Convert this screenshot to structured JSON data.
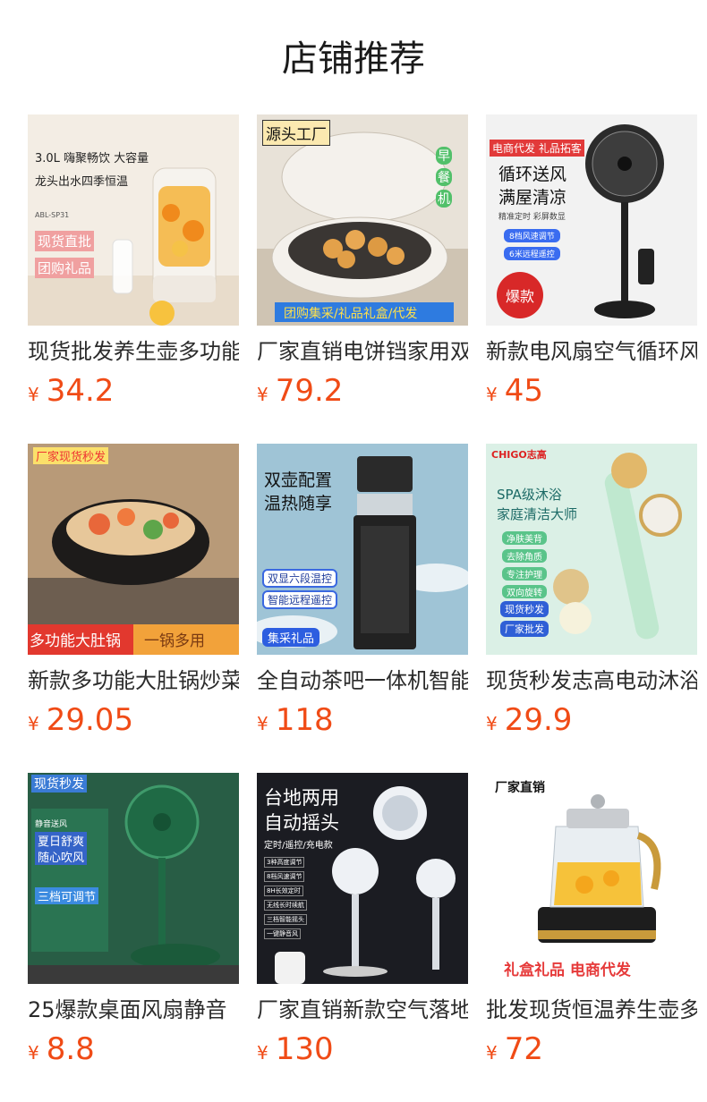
{
  "page_title": "店铺推荐",
  "currency_symbol": "¥",
  "products": [
    {
      "name": "现货批发养生壶多功能",
      "price": "34.2",
      "overlay": {
        "lines": [
          "3.0L 嗨聚畅饮 大容量",
          "龙头出水四季恒温",
          "ABL-SP31",
          "现货直批",
          "团购礼品"
        ]
      }
    },
    {
      "name": "厂家直销电饼铛家用双面",
      "price": "79.2",
      "overlay": {
        "lines": [
          "源头工厂",
          "早",
          "餐",
          "机",
          "团购集采/礼品礼盒/代发"
        ]
      }
    },
    {
      "name": "新款电风扇空气循环风扇",
      "price": "45",
      "overlay": {
        "lines": [
          "电商代发 礼品拓客",
          "循环送风",
          "满屋清凉",
          "精准定时 彩屏数显",
          "8档风速调节",
          "6米远程遥控",
          "爆款"
        ]
      }
    },
    {
      "name": "新款多功能大肚锅炒菜锅",
      "price": "29.05",
      "overlay": {
        "lines": [
          "厂家现货秒发",
          "多功能大肚锅",
          "一锅多用"
        ]
      }
    },
    {
      "name": "全自动茶吧一体机智能",
      "price": "118",
      "overlay": {
        "lines": [
          "双壶配置",
          "温热随享",
          "双显六段温控",
          "智能远程遥控",
          "集采礼品"
        ]
      }
    },
    {
      "name": "现货秒发志高电动沐浴刷",
      "price": "29.9",
      "overlay": {
        "lines": [
          "CHIGO志高",
          "SPA级沐浴",
          "家庭清洁大师",
          "净肤美背",
          "去除角质",
          "专注护理",
          "双向旋转",
          "现货秒发",
          "厂家批发"
        ]
      }
    },
    {
      "name": "25爆款桌面风扇静音",
      "price": "8.8",
      "overlay": {
        "lines": [
          "现货秒发",
          "静音送风",
          "夏日舒爽",
          "随心吹风",
          "三档可调节"
        ]
      }
    },
    {
      "name": "厂家直销新款空气落地扇",
      "price": "130",
      "overlay": {
        "lines": [
          "台地两用",
          "自动摇头",
          "定时/遥控/充电款",
          "3种高度调节",
          "8档风速调节",
          "8H长效定时",
          "无线长时续航",
          "三档智能摇头",
          "一键静音风"
        ]
      }
    },
    {
      "name": "批发现货恒温养生壶多功能",
      "price": "72",
      "overlay": {
        "lines": [
          "厂家直销",
          "礼盒礼品 电商代发"
        ]
      }
    }
  ],
  "colors": {
    "price": "#f04b16",
    "title": "#1a1a1a",
    "name": "#2b2b2b"
  }
}
